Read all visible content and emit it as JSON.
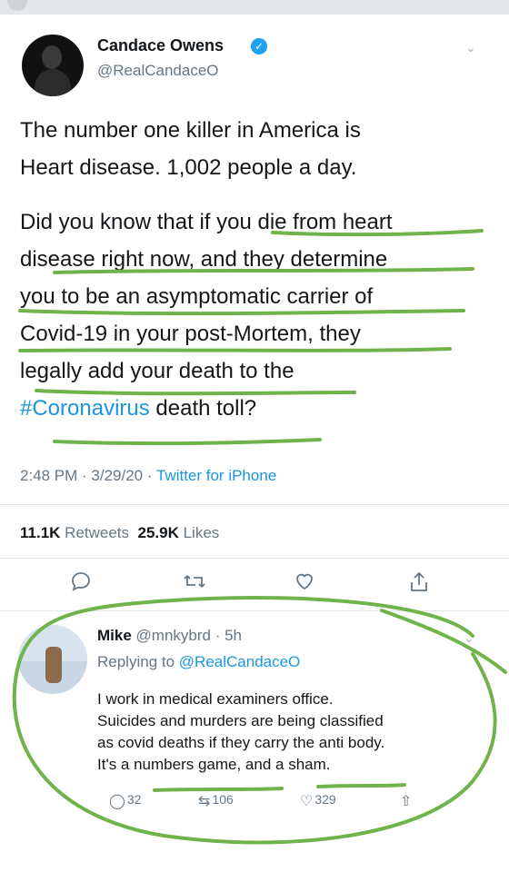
{
  "tweet": {
    "author_name": "Candace Owens",
    "author_handle": "@RealCandaceO",
    "text_lines_1": [
      "The number one killer in America is",
      "Heart disease. 1,002 people a day."
    ],
    "text_lines_2": [
      "Did you know that if you die from heart",
      "disease right now, and they determine",
      "you to be an asymptomatic carrier of",
      "Covid-19 in your post-Mortem, they",
      "legally add your death to the"
    ],
    "last_line": {
      "hashtag": "#Coronavirus",
      "rest": " death toll?"
    },
    "meta": {
      "time": "2:48 PM",
      "sep1": " · ",
      "date": "3/29/20",
      "sep2": " · ",
      "source": "Twitter for iPhone"
    },
    "stats": {
      "retweets_count": "11.1K",
      "retweets_label": " Retweets",
      "likes_count": "25.9K",
      "likes_label": " Likes"
    }
  },
  "reply": {
    "author_name": "Mike",
    "author_handle": "@mnkybrd",
    "sep": " · ",
    "age": "5h",
    "replying_label": "Replying to ",
    "replying_handle": "@RealCandaceO",
    "text_lines": [
      "I work in medical examiners office.",
      "Suicides and murders are being classified",
      "as covid deaths if they carry the anti body.",
      "It's a numbers game, and a sham."
    ],
    "reply_count": "32",
    "retweet_count": "106",
    "like_count": "329"
  },
  "icons": {
    "verified": "verified-badge-icon",
    "reply": "reply-icon",
    "retweet": "retweet-icon",
    "like": "heart-icon",
    "share": "share-icon",
    "chevron": "chevron-down-icon"
  },
  "colors": {
    "link_blue": "#1b95e0",
    "verified_blue": "#1da1f2",
    "annotation_green": "#6fb34a",
    "secondary_gray": "#657786"
  }
}
